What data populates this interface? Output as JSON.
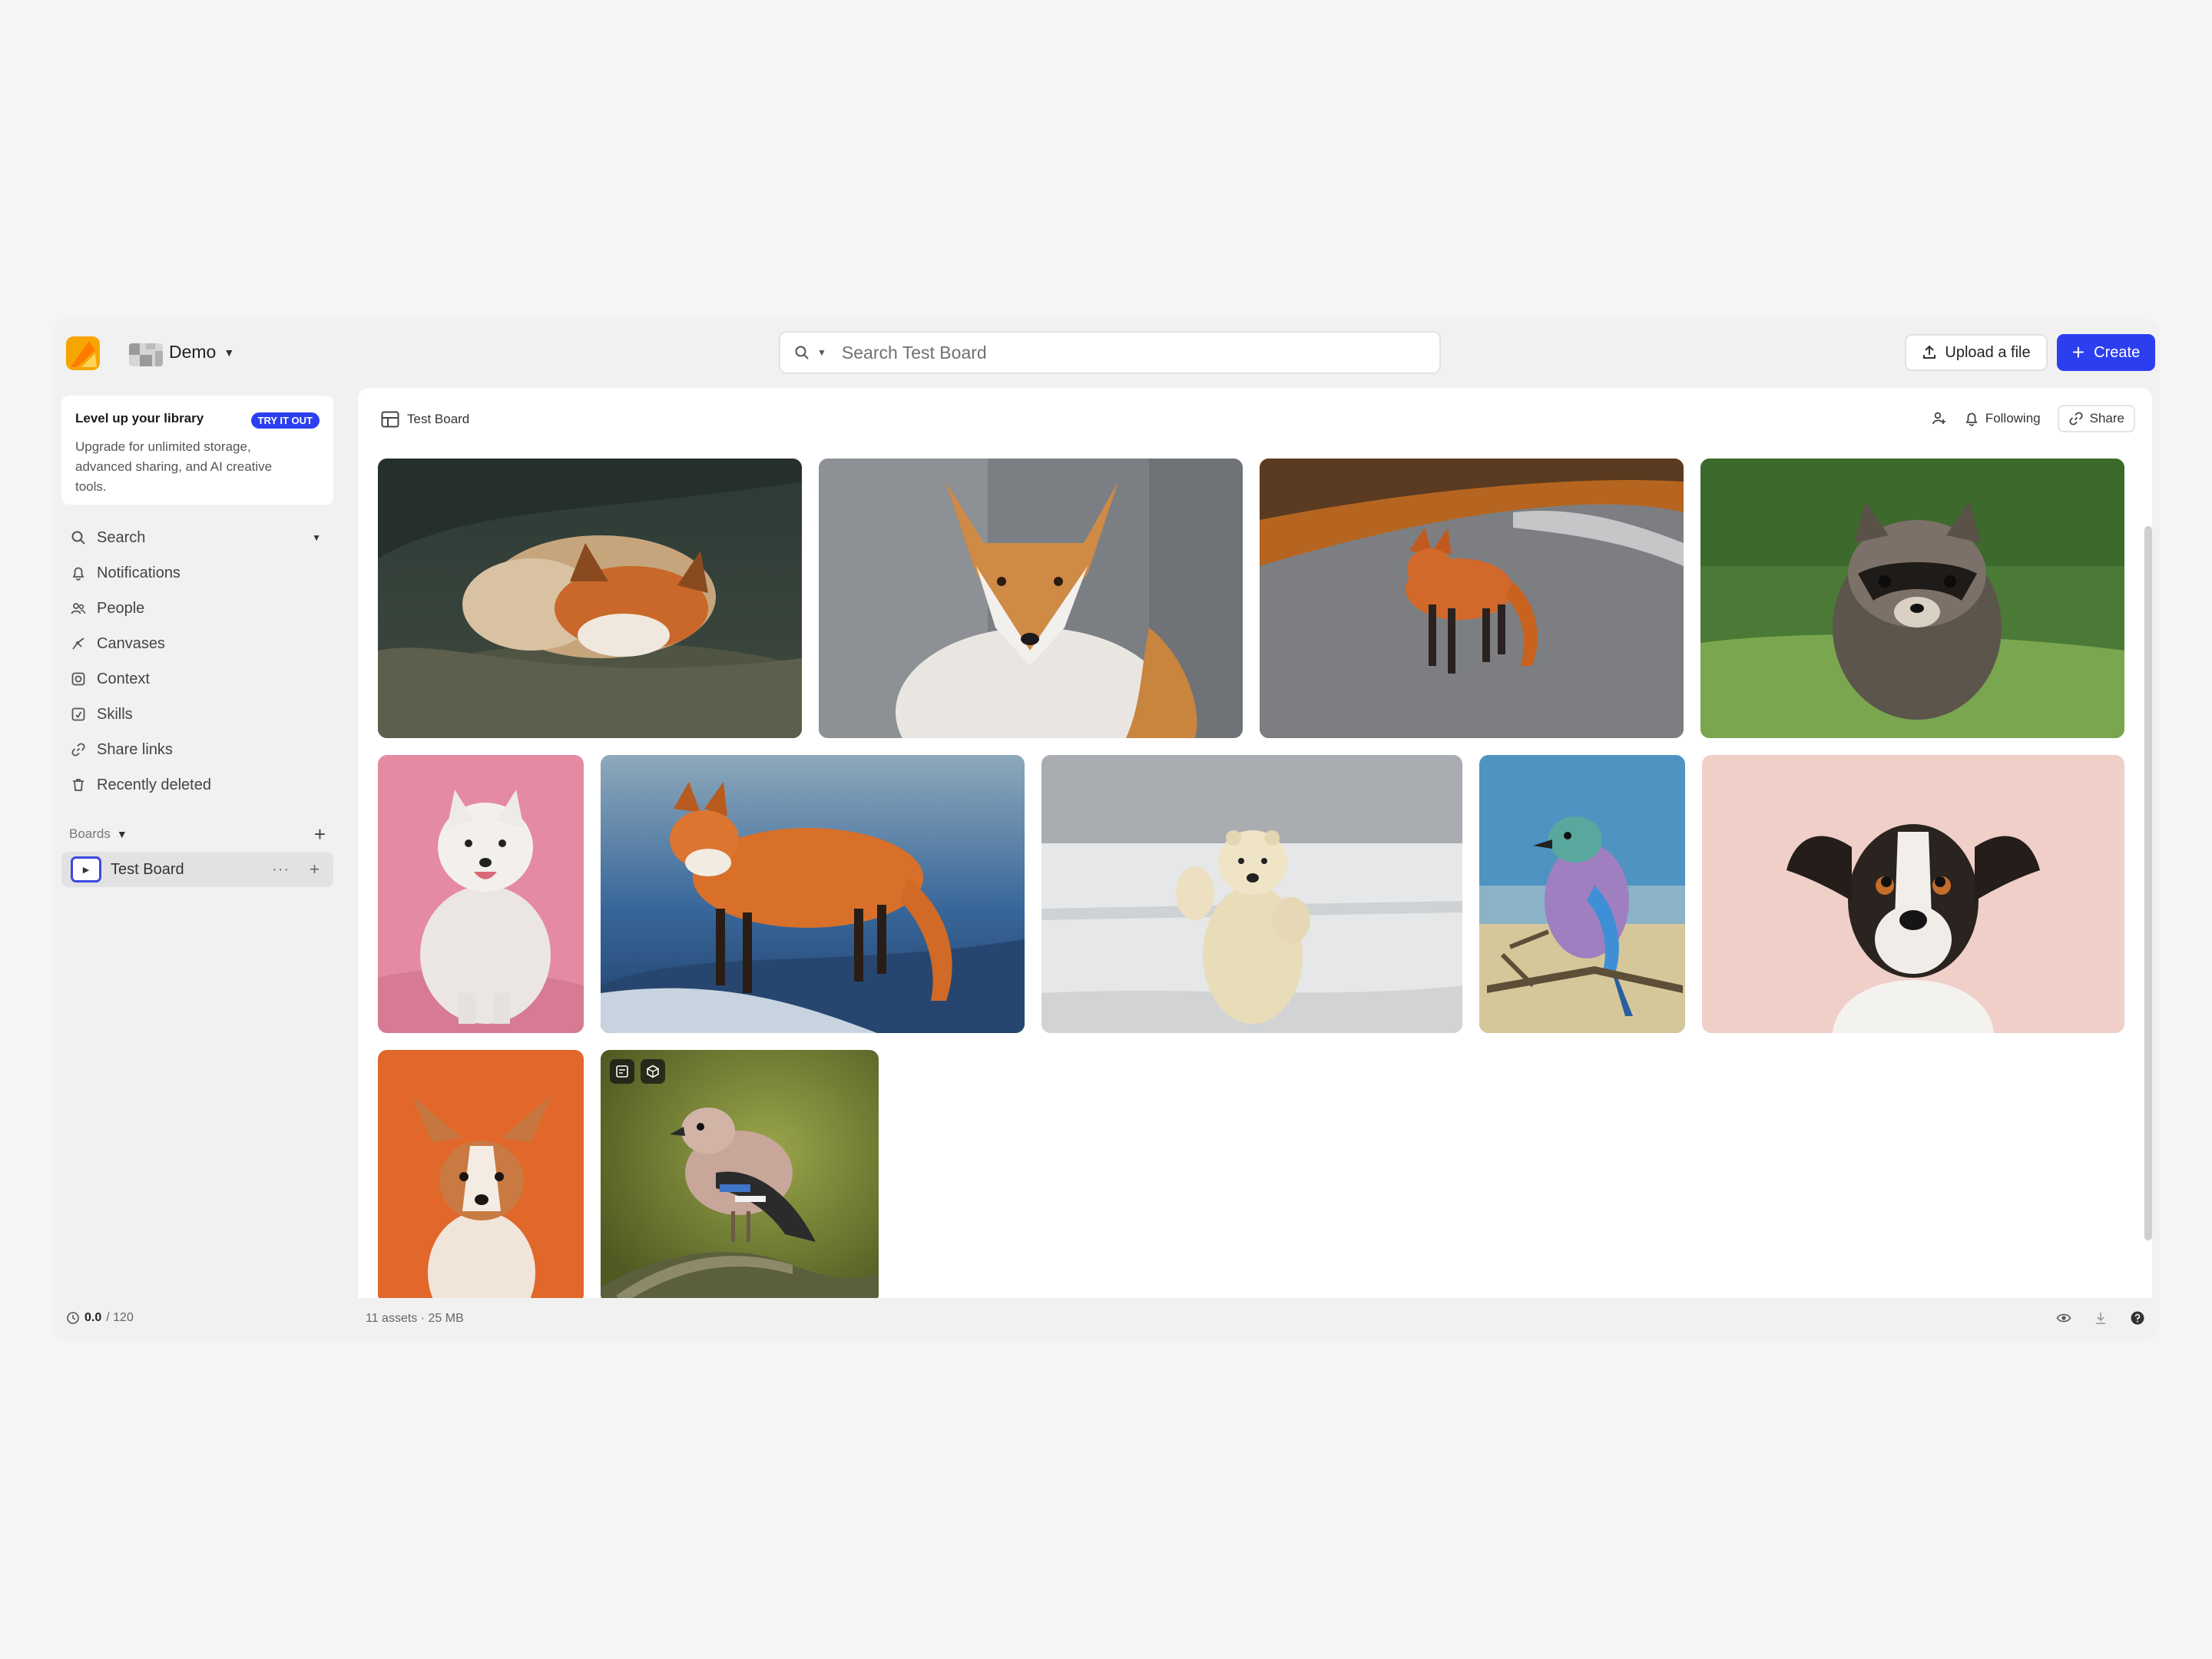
{
  "app": {
    "workspace_name": "Demo",
    "search_placeholder": "Search Test Board",
    "upload_label": "Upload a file",
    "create_label": "Create",
    "accent_color": "#2c3ff0"
  },
  "promo": {
    "title": "Level up your library",
    "badge": "TRY IT OUT",
    "text": "Upgrade for unlimited storage, advanced sharing, and AI creative tools."
  },
  "sidebar": {
    "items": [
      {
        "label": "Search",
        "icon": "search-icon"
      },
      {
        "label": "Notifications",
        "icon": "bell-icon"
      },
      {
        "label": "People",
        "icon": "people-icon"
      },
      {
        "label": "Canvases",
        "icon": "canvas-icon"
      },
      {
        "label": "Context",
        "icon": "context-icon"
      },
      {
        "label": "Skills",
        "icon": "skills-icon"
      },
      {
        "label": "Share links",
        "icon": "link-icon"
      },
      {
        "label": "Recently deleted",
        "icon": "trash-icon"
      }
    ],
    "boards_label": "Boards",
    "boards": [
      {
        "label": "Test Board"
      }
    ]
  },
  "board": {
    "title": "Test Board",
    "following_label": "Following",
    "share_label": "Share"
  },
  "gallery": [
    {
      "subject": "sleeping red fox"
    },
    {
      "subject": "red fox in snow"
    },
    {
      "subject": "red fox on road"
    },
    {
      "subject": "raccoon on grass"
    },
    {
      "subject": "white samoyed dog"
    },
    {
      "subject": "red fox at dusk"
    },
    {
      "subject": "standing polar bear"
    },
    {
      "subject": "lilac-breasted roller"
    },
    {
      "subject": "jack russell terrier"
    },
    {
      "subject": "corgi puppy"
    },
    {
      "subject": "eurasian jay on branch"
    }
  ],
  "footer": {
    "credits_used": "0.0",
    "credits_total": "/ 120",
    "asset_summary": "11 assets · 25 MB"
  }
}
